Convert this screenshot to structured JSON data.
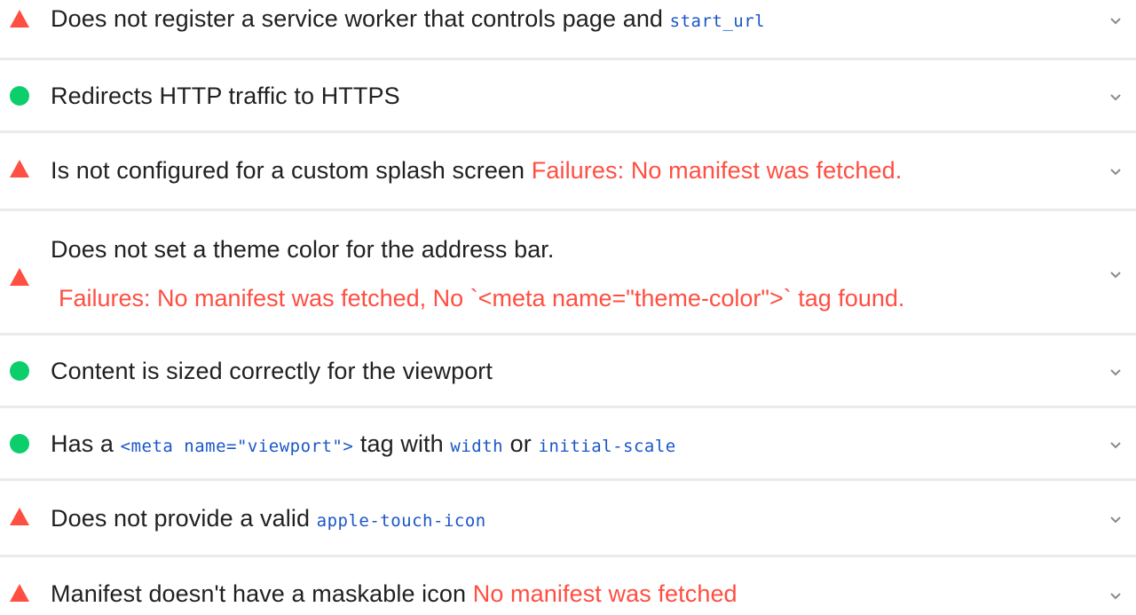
{
  "colors": {
    "fail": "#ff4e42",
    "pass": "#0cce6b",
    "code": "#1a56c8",
    "text": "#212121",
    "chevron": "#8a8a8a",
    "divider": "#ebebeb"
  },
  "audits": [
    {
      "status": "fail",
      "icon": "warning-triangle-icon",
      "parts": [
        {
          "t": "text",
          "v": "Does not register a service worker that controls page and "
        },
        {
          "t": "code",
          "v": "start_url"
        }
      ]
    },
    {
      "status": "pass",
      "icon": "pass-circle-icon",
      "parts": [
        {
          "t": "text",
          "v": "Redirects HTTP traffic to HTTPS"
        }
      ]
    },
    {
      "status": "fail",
      "icon": "warning-triangle-icon",
      "parts": [
        {
          "t": "text",
          "v": "Is not configured for a custom splash screen "
        },
        {
          "t": "fail",
          "v": "Failures: No manifest was fetched."
        }
      ]
    },
    {
      "status": "fail",
      "icon": "warning-triangle-icon",
      "parts": [
        {
          "t": "text",
          "v": "Does not set a theme color for the address bar."
        }
      ],
      "detail": "Failures: No manifest was fetched, No `<meta name=\"theme-color\">` tag found."
    },
    {
      "status": "pass",
      "icon": "pass-circle-icon",
      "parts": [
        {
          "t": "text",
          "v": "Content is sized correctly for the viewport"
        }
      ]
    },
    {
      "status": "pass",
      "icon": "pass-circle-icon",
      "parts": [
        {
          "t": "text",
          "v": "Has a "
        },
        {
          "t": "code",
          "v": "<meta name=\"viewport\">"
        },
        {
          "t": "text",
          "v": " tag with "
        },
        {
          "t": "code",
          "v": "width"
        },
        {
          "t": "text",
          "v": " or "
        },
        {
          "t": "code",
          "v": "initial-scale"
        }
      ]
    },
    {
      "status": "fail",
      "icon": "warning-triangle-icon",
      "parts": [
        {
          "t": "text",
          "v": "Does not provide a valid "
        },
        {
          "t": "code",
          "v": "apple-touch-icon"
        }
      ]
    },
    {
      "status": "fail",
      "icon": "warning-triangle-icon",
      "parts": [
        {
          "t": "text",
          "v": "Manifest doesn't have a maskable icon "
        },
        {
          "t": "fail",
          "v": "No manifest was fetched"
        }
      ]
    }
  ]
}
